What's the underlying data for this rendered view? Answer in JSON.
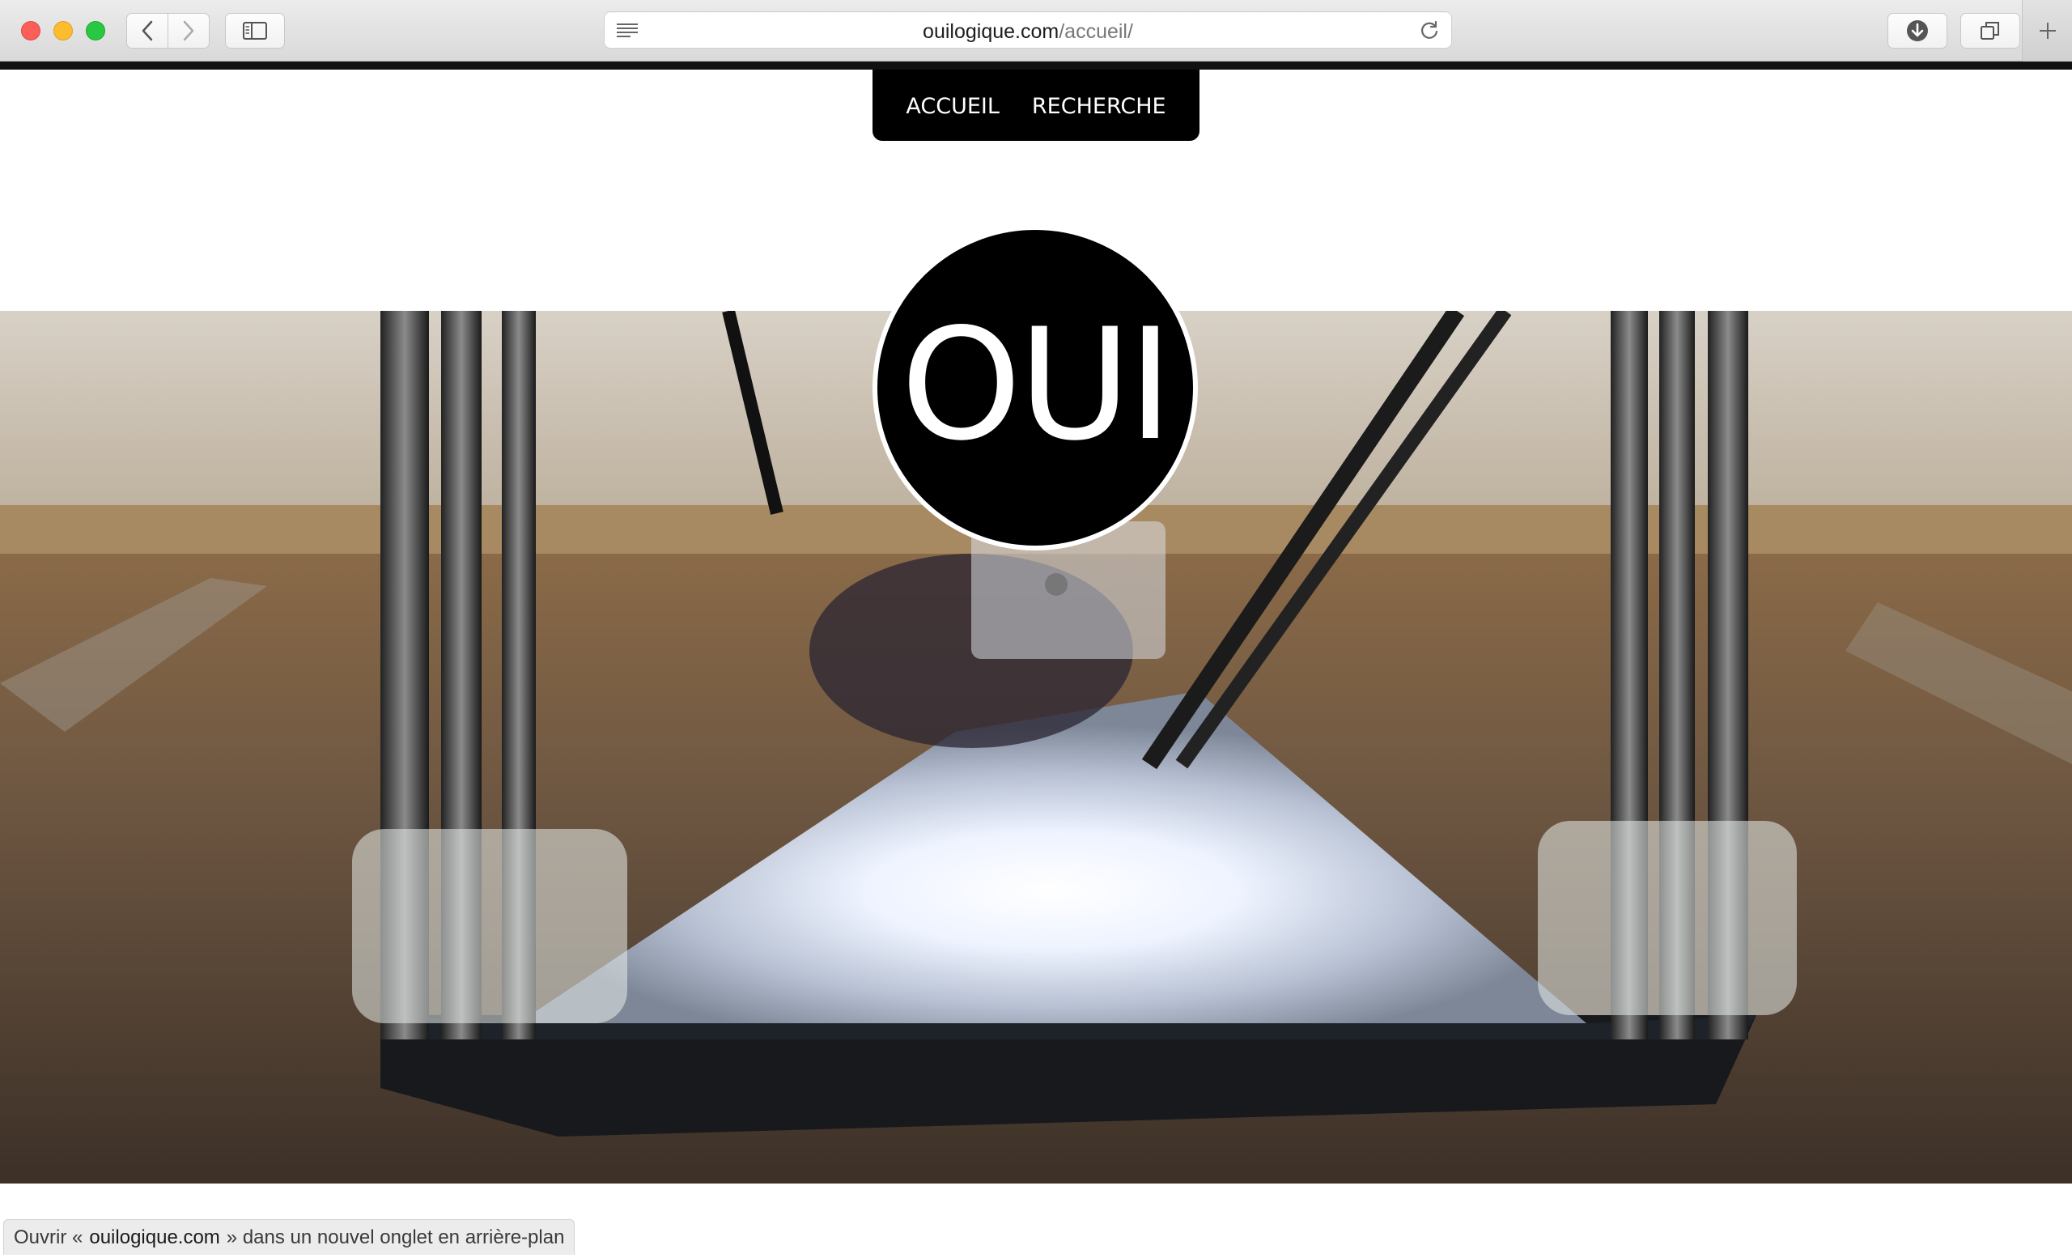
{
  "browser": {
    "url_host": "ouilogique.com",
    "url_path": "/accueil/",
    "icons": {
      "back": "chevron-left-icon",
      "forward": "chevron-right-icon",
      "sidebar": "sidebar-icon",
      "reader": "reader-lines-icon",
      "reload": "reload-icon",
      "downloads": "download-icon",
      "tabs": "tabs-overview-icon",
      "new_tab": "plus-icon"
    }
  },
  "nav": {
    "items": [
      {
        "label": "ACCUEIL"
      },
      {
        "label": "RECHERCHE"
      }
    ]
  },
  "logo": {
    "text": "OUI"
  },
  "status": {
    "prefix": "Ouvrir «",
    "host": "ouilogique.com",
    "suffix": "» dans un nouvel onglet en arrière-plan"
  },
  "colors": {
    "nav_background": "#000000",
    "logo_background": "#000000",
    "logo_text": "#ffffff",
    "close": "#fc5f57",
    "minimize": "#fdbc2e",
    "zoom": "#28c840"
  }
}
